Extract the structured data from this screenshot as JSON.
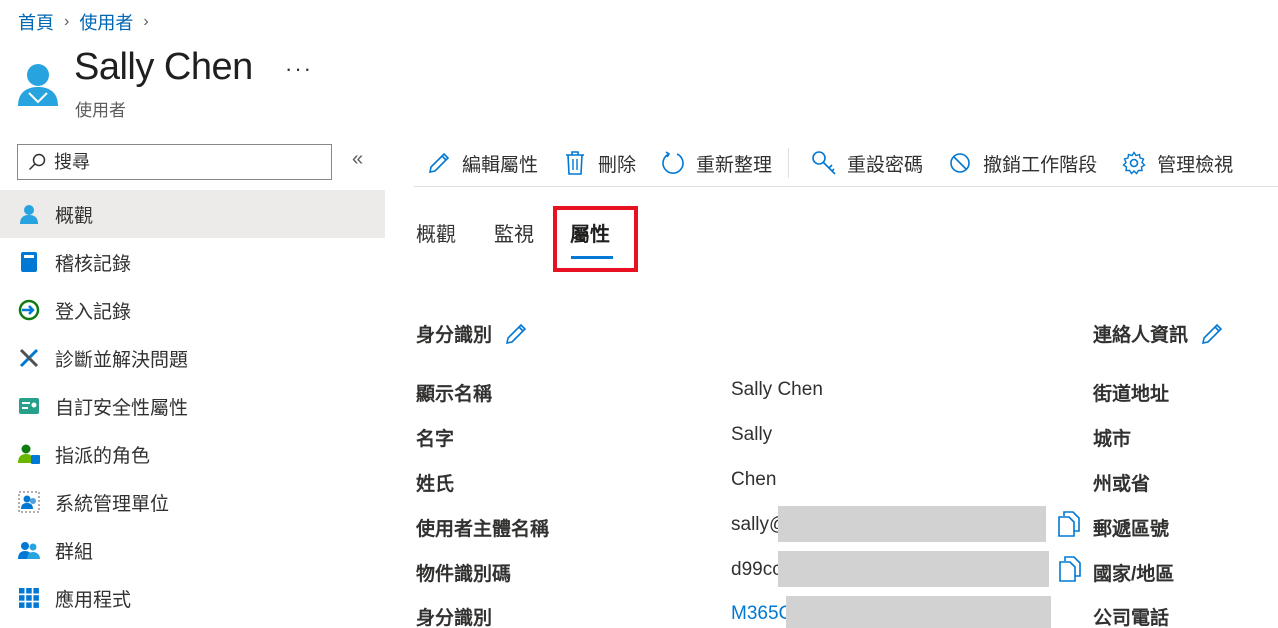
{
  "breadcrumb": {
    "home": "首頁",
    "users": "使用者"
  },
  "header": {
    "title": "Sally Chen",
    "subtitle": "使用者",
    "more": "···"
  },
  "search": {
    "placeholder": "搜尋"
  },
  "sidebar": {
    "items": [
      {
        "label": "概觀",
        "icon": "user-icon",
        "active": true
      },
      {
        "label": "稽核記錄",
        "icon": "audit-log-icon"
      },
      {
        "label": "登入記錄",
        "icon": "sign-in-icon"
      },
      {
        "label": "診斷並解決問題",
        "icon": "tools-icon"
      },
      {
        "label": "自訂安全性屬性",
        "icon": "security-attributes-icon"
      },
      {
        "label": "指派的角色",
        "icon": "roles-icon"
      },
      {
        "label": "系統管理單位",
        "icon": "admin-units-icon"
      },
      {
        "label": "群組",
        "icon": "groups-icon"
      },
      {
        "label": "應用程式",
        "icon": "apps-grid-icon"
      }
    ]
  },
  "toolbar": {
    "edit": "編輯屬性",
    "delete": "刪除",
    "refresh": "重新整理",
    "reset_password": "重設密碼",
    "revoke_sessions": "撤銷工作階段",
    "manage_view": "管理檢視"
  },
  "tabs": [
    {
      "label": "概觀"
    },
    {
      "label": "監視"
    },
    {
      "label": "屬性",
      "active": true
    }
  ],
  "identity": {
    "title": "身分識別",
    "rows": [
      {
        "label": "顯示名稱",
        "value": "Sally Chen"
      },
      {
        "label": "名字",
        "value": "Sally"
      },
      {
        "label": "姓氏",
        "value": "Chen"
      },
      {
        "label": "使用者主體名稱",
        "value": "sally@"
      },
      {
        "label": "物件識別碼",
        "value": "d99cc"
      },
      {
        "label": "身分識別",
        "value": "M365C"
      }
    ]
  },
  "contact": {
    "title": "連絡人資訊",
    "rows": [
      "街道地址",
      "城市",
      "州或省",
      "郵遞區號",
      "國家/地區",
      "公司電話"
    ]
  },
  "colors": {
    "accent": "#0078d4",
    "link": "#0066b4",
    "highlight": "#e81123",
    "redaction": "#d2d2d2"
  }
}
